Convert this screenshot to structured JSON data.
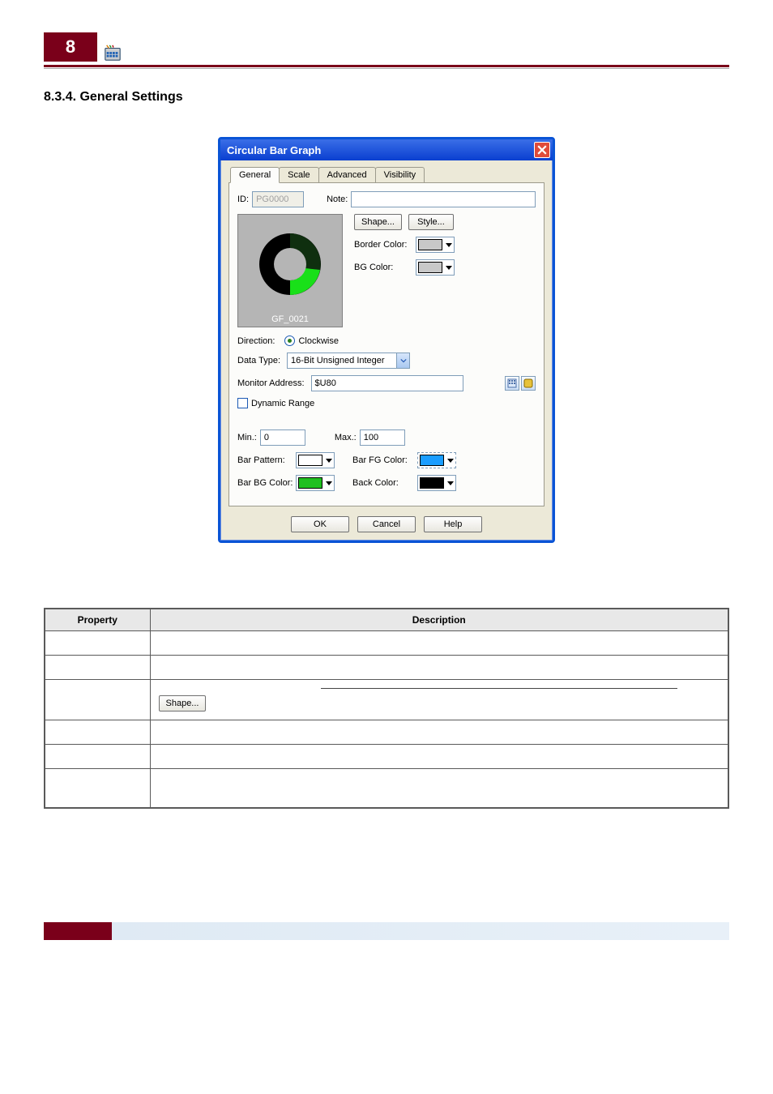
{
  "page": {
    "chapter_num": "8",
    "heading": "8.3.4. General Settings"
  },
  "dialog": {
    "title": "Circular Bar Graph",
    "tabs": [
      "General",
      "Scale",
      "Advanced",
      "Visibility"
    ],
    "id_label": "ID:",
    "id_value": "PG0000",
    "note_label": "Note:",
    "note_value": "",
    "shape_btn": "Shape...",
    "style_btn": "Style...",
    "border_color_label": "Border Color:",
    "bg_color_label": "BG Color:",
    "preview_label": "GF_0021",
    "direction_label": "Direction:",
    "direction_opt": "Clockwise",
    "data_type_label": "Data Type:",
    "data_type_value": "16-Bit Unsigned Integer",
    "monitor_label": "Monitor Address:",
    "monitor_value": "$U80",
    "dynamic_range": "Dynamic Range",
    "min_label": "Min.:",
    "min_value": "0",
    "max_label": "Max.:",
    "max_value": "100",
    "bar_pattern_label": "Bar Pattern:",
    "bar_fg_label": "Bar FG Color:",
    "bar_bg_label": "Bar BG Color:",
    "back_color_label": "Back Color:",
    "ok": "OK",
    "cancel": "Cancel",
    "help": "Help",
    "colors": {
      "border": "#c8c8c8",
      "bg": "#c8c8c8",
      "bar_pattern": "#ffffff",
      "bar_fg": "#1a9dff",
      "bar_bg": "#20c020",
      "back": "#000000"
    }
  },
  "table": {
    "col_property": "Property",
    "col_description": "Description",
    "rows": [
      {
        "prop": "",
        "desc": ""
      },
      {
        "prop": "",
        "desc": ""
      },
      {
        "prop": "",
        "desc": "shape_btn"
      },
      {
        "prop": "",
        "desc": ""
      },
      {
        "prop": "",
        "desc": ""
      },
      {
        "prop": "",
        "desc": ""
      }
    ],
    "shape_btn_label": "Shape..."
  }
}
